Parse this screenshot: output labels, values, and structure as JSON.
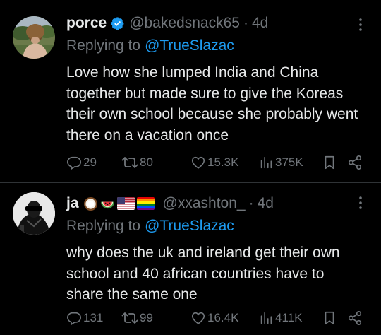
{
  "tweets": [
    {
      "display_name": "porce",
      "verified_icon": "verified-badge-icon",
      "handle": "@bakedsnack65",
      "separator": "·",
      "time": "4d",
      "replying_prefix": "Replying to",
      "replying_to": "@TrueSlazac",
      "text": "Love how she lumped India and China together but made sure to give the Koreas their own school because she probably went there on a vacation once",
      "replies": "29",
      "reposts": "80",
      "likes": "15.3K",
      "views": "375K"
    },
    {
      "display_name": "ja",
      "name_emojis": [
        "coconut-emoji",
        "watermelon-emoji",
        "us-flag-emoji",
        "rainbow-flag-emoji"
      ],
      "handle": "@xxashton_",
      "separator": "·",
      "time": "4d",
      "replying_prefix": "Replying to",
      "replying_to": "@TrueSlazac",
      "text": "why does the uk and ireland get their own school and 40 african countries have to share the same one",
      "replies": "131",
      "reposts": "99",
      "likes": "16.4K",
      "views": "411K"
    }
  ],
  "colors": {
    "background": "#000000",
    "text": "#e7e9ea",
    "muted": "#71767b",
    "accent": "#1d9bf0",
    "divider": "#2f3336"
  }
}
